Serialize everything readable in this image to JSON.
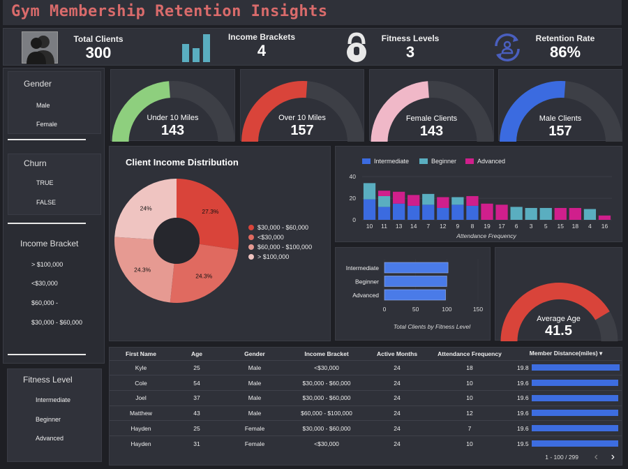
{
  "title": "Gym Membership Retention Insights",
  "kpis": [
    {
      "label": "Total Clients",
      "value": "300",
      "icon": "users-icon"
    },
    {
      "label": "Income Brackets",
      "value": "4",
      "icon": "bar-chart-icon"
    },
    {
      "label": "Fitness Levels",
      "value": "3",
      "icon": "kettlebell-icon"
    },
    {
      "label": "Retention Rate",
      "value": "86%",
      "icon": "refresh-user-icon"
    }
  ],
  "filters": {
    "gender": {
      "title": "Gender",
      "items": [
        "Male",
        "Female"
      ]
    },
    "churn": {
      "title": "Churn",
      "items": [
        "TRUE",
        "FALSE"
      ]
    },
    "income": {
      "title": "Income Bracket",
      "items": [
        "> $100,000",
        "<$30,000",
        "$60,000 -",
        "$30,000 - $60,000"
      ]
    },
    "fitness": {
      "title": "Fitness Level",
      "items": [
        "Intermediate",
        "Beginner",
        "Advanced"
      ]
    }
  },
  "gauges": [
    {
      "label": "Under 10 Miles",
      "value": "143",
      "fraction": 0.477,
      "color": "#8ecf7e"
    },
    {
      "label": "Over 10 Miles",
      "value": "157",
      "fraction": 0.523,
      "color": "#d9443a"
    },
    {
      "label": "Female Clients",
      "value": "143",
      "fraction": 0.477,
      "color": "#f0b8c8"
    },
    {
      "label": "Male Clients",
      "value": "157",
      "fraction": 0.523,
      "color": "#3b6be0"
    }
  ],
  "age_gauge": {
    "label": "Average Age",
    "value": "41.5",
    "fraction": 0.83,
    "color": "#d9443a"
  },
  "colors": {
    "intermediate": "#3b6be0",
    "beginner": "#5aaec0",
    "advanced": "#d01f8c",
    "donut": [
      "#d9443a",
      "#e06a60",
      "#e69a92",
      "#efc4c1"
    ]
  },
  "chart_data": [
    {
      "type": "pie",
      "title": "Client Income Distribution",
      "categories": [
        "$30,000 - $60,000",
        "<$30,000",
        "$60,000 - $100,000",
        "> $100,000"
      ],
      "values": [
        27.3,
        24.3,
        24.3,
        24
      ],
      "labels": [
        "27.3%",
        "24.3%",
        "24.3%",
        "24%"
      ]
    },
    {
      "type": "bar",
      "stacked": true,
      "xlabel": "Attendance Frequency",
      "categories": [
        "10",
        "11",
        "13",
        "14",
        "7",
        "12",
        "9",
        "8",
        "19",
        "17",
        "6",
        "3",
        "5",
        "15",
        "18",
        "4",
        "16"
      ],
      "series": [
        {
          "name": "Intermediate",
          "values": [
            19,
            12,
            15,
            13,
            14,
            11,
            14,
            13,
            0,
            0,
            0,
            0,
            0,
            0,
            0,
            0,
            0
          ]
        },
        {
          "name": "Beginner",
          "values": [
            15,
            10,
            0,
            0,
            10,
            0,
            7,
            0,
            0,
            0,
            12,
            11,
            11,
            0,
            0,
            10,
            0
          ]
        },
        {
          "name": "Advanced",
          "values": [
            0,
            5,
            11,
            10,
            0,
            10,
            0,
            9,
            15,
            14,
            0,
            0,
            0,
            11,
            11,
            0,
            4
          ]
        }
      ],
      "yticks": [
        0,
        20,
        40
      ],
      "ylim": [
        0,
        42
      ]
    },
    {
      "type": "bar",
      "orientation": "horizontal",
      "xlabel": "Total Clients by Fitness Level",
      "categories": [
        "Intermediate",
        "Beginner",
        "Advanced"
      ],
      "values": [
        102,
        100,
        98
      ],
      "xticks": [
        0,
        50,
        100,
        150
      ],
      "xlim": [
        0,
        150
      ]
    }
  ],
  "table": {
    "columns": [
      "First Name",
      "Age",
      "Gender",
      "Income Bracket",
      "Active Months",
      "Attendance Frequency",
      "Member Distance(miles)"
    ],
    "sort_indicator": "▾",
    "max_distance": 19.8,
    "rows": [
      {
        "name": "Kyle",
        "age": "25",
        "gender": "Male",
        "income": "<$30,000",
        "months": "24",
        "freq": "18",
        "dist": "19.8"
      },
      {
        "name": "Cole",
        "age": "54",
        "gender": "Male",
        "income": "$30,000 - $60,000",
        "months": "24",
        "freq": "10",
        "dist": "19.6"
      },
      {
        "name": "Joel",
        "age": "37",
        "gender": "Male",
        "income": "$30,000 - $60,000",
        "months": "24",
        "freq": "10",
        "dist": "19.6"
      },
      {
        "name": "Matthew",
        "age": "43",
        "gender": "Male",
        "income": "$60,000 - $100,000",
        "months": "24",
        "freq": "12",
        "dist": "19.6"
      },
      {
        "name": "Hayden",
        "age": "25",
        "gender": "Female",
        "income": "$30,000 - $60,000",
        "months": "24",
        "freq": "7",
        "dist": "19.6"
      },
      {
        "name": "Hayden",
        "age": "31",
        "gender": "Female",
        "income": "<$30,000",
        "months": "24",
        "freq": "10",
        "dist": "19.5"
      }
    ],
    "pagination": "1 - 100 / 299",
    "prev": "‹",
    "next": "›"
  }
}
